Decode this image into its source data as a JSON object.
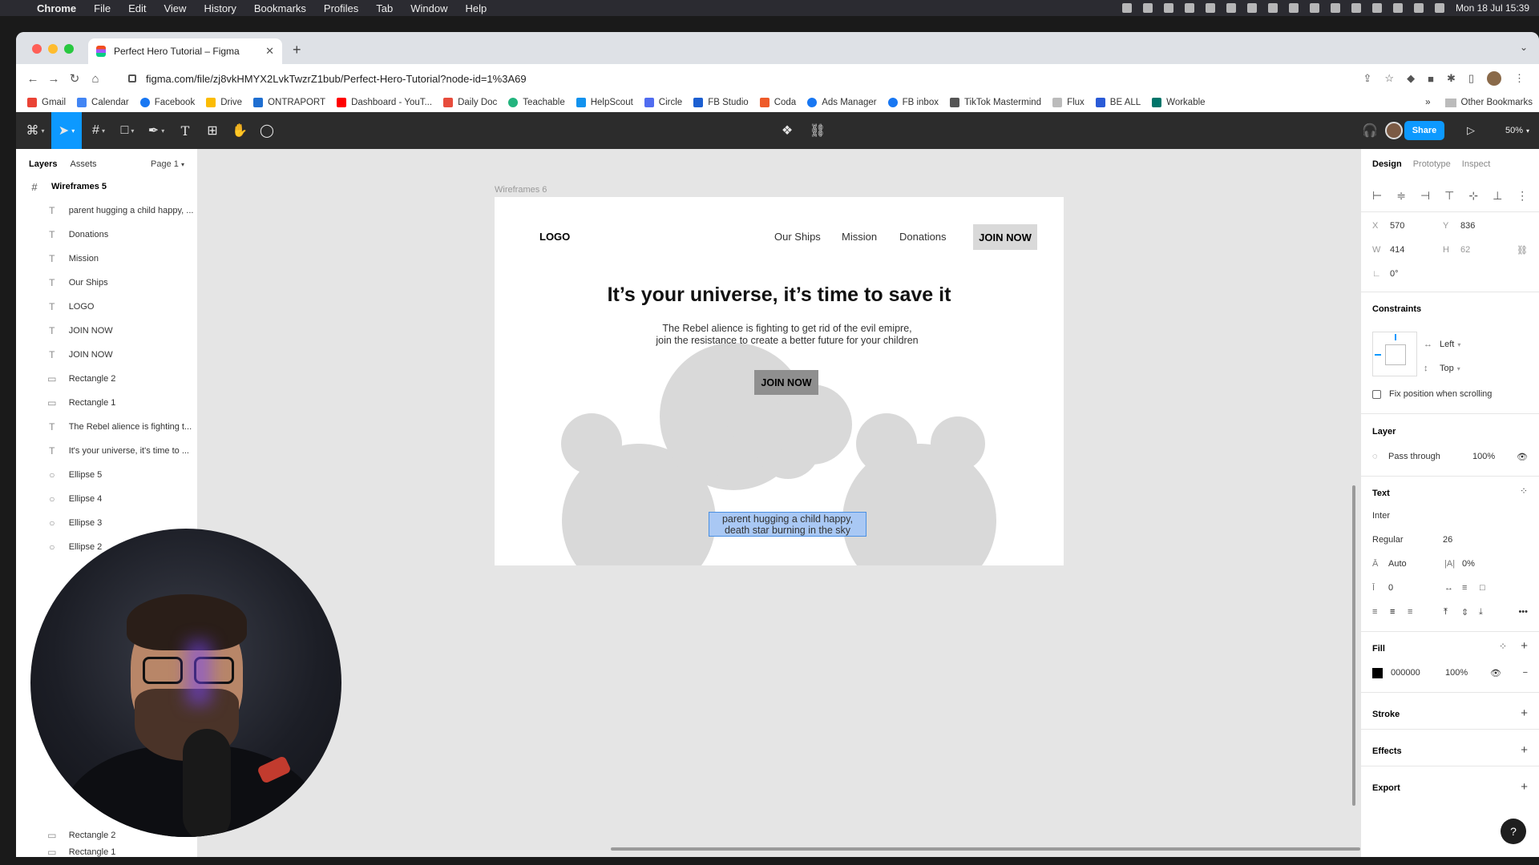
{
  "menubar": {
    "app": "Chrome",
    "items": [
      "File",
      "Edit",
      "View",
      "History",
      "Bookmarks",
      "Profiles",
      "Tab",
      "Window",
      "Help"
    ],
    "clock": "Mon 18 Jul  15:39"
  },
  "browser": {
    "tab_title": "Perfect Hero Tutorial – Figma",
    "url": "figma.com/file/zj8vkHMYX2LvkTwzrZ1bub/Perfect-Hero-Tutorial?node-id=1%3A69",
    "bookmarks": [
      "Gmail",
      "Calendar",
      "Facebook",
      "Drive",
      "ONTRAPORT",
      "Dashboard - YouT...",
      "Daily Doc",
      "Teachable",
      "HelpScout",
      "Circle",
      "FB Studio",
      "Coda",
      "Ads Manager",
      "FB inbox",
      "TikTok Mastermind",
      "Flux",
      "BE ALL",
      "Workable"
    ],
    "other_bookmarks": "Other Bookmarks",
    "more": "»"
  },
  "figma_toolbar": {
    "share": "Share",
    "zoom": "50%"
  },
  "layers_panel": {
    "tab_layers": "Layers",
    "tab_assets": "Assets",
    "page": "Page 1",
    "frame_name": "Wireframes 5",
    "items": [
      {
        "icon": "T",
        "name": "parent hugging a child happy, ..."
      },
      {
        "icon": "T",
        "name": "Donations"
      },
      {
        "icon": "T",
        "name": "Mission"
      },
      {
        "icon": "T",
        "name": "Our Ships"
      },
      {
        "icon": "T",
        "name": "LOGO"
      },
      {
        "icon": "T",
        "name": "JOIN NOW"
      },
      {
        "icon": "T",
        "name": "JOIN NOW"
      },
      {
        "icon": "▭",
        "name": "Rectangle 2"
      },
      {
        "icon": "▭",
        "name": "Rectangle 1"
      },
      {
        "icon": "T",
        "name": "The Rebel alience is fighting t..."
      },
      {
        "icon": "T",
        "name": "It's your universe, it's time to ..."
      },
      {
        "icon": "○",
        "name": "Ellipse 5"
      },
      {
        "icon": "○",
        "name": "Ellipse 4"
      },
      {
        "icon": "○",
        "name": "Ellipse 3"
      },
      {
        "icon": "○",
        "name": "Ellipse 2"
      }
    ],
    "bottom_items": [
      {
        "icon": "▭",
        "name": "Rectangle 2"
      },
      {
        "icon": "▭",
        "name": "Rectangle 1"
      }
    ]
  },
  "canvas": {
    "frame_label": "Wireframes 6",
    "wireframe": {
      "logo": "LOGO",
      "nav": [
        "Our Ships",
        "Mission",
        "Donations"
      ],
      "join_top": "JOIN NOW",
      "headline": "It’s your universe, it’s time to save it",
      "subtext": "The Rebel alience is fighting to get rid of the evil emipre, join the resistance to create a better future for your children",
      "join_mid": "JOIN NOW",
      "caption": "parent hugging a child happy, death star burning in the sky"
    }
  },
  "design_panel": {
    "tabs": [
      "Design",
      "Prototype",
      "Inspect"
    ],
    "x_label": "X",
    "x": "570",
    "y_label": "Y",
    "y": "836",
    "w_label": "W",
    "w": "414",
    "h_label": "H",
    "h": "62",
    "rotation": "0°",
    "constraints_title": "Constraints",
    "constraint_h": "Left",
    "constraint_v": "Top",
    "fix_position": "Fix position when scrolling",
    "layer_title": "Layer",
    "blend": "Pass through",
    "opacity": "100%",
    "text_title": "Text",
    "font": "Inter",
    "weight": "Regular",
    "size": "26",
    "line_height": "Auto",
    "letter_spacing": "0%",
    "paragraph_spacing": "0",
    "fill_title": "Fill",
    "fill_hex": "000000",
    "fill_opacity": "100%",
    "stroke_title": "Stroke",
    "effects_title": "Effects",
    "export_title": "Export",
    "help": "?"
  },
  "colors": {
    "figma_blue": "#0d99ff",
    "placeholder_gray": "#d9d9d9",
    "selection": "#a9c8f4"
  }
}
